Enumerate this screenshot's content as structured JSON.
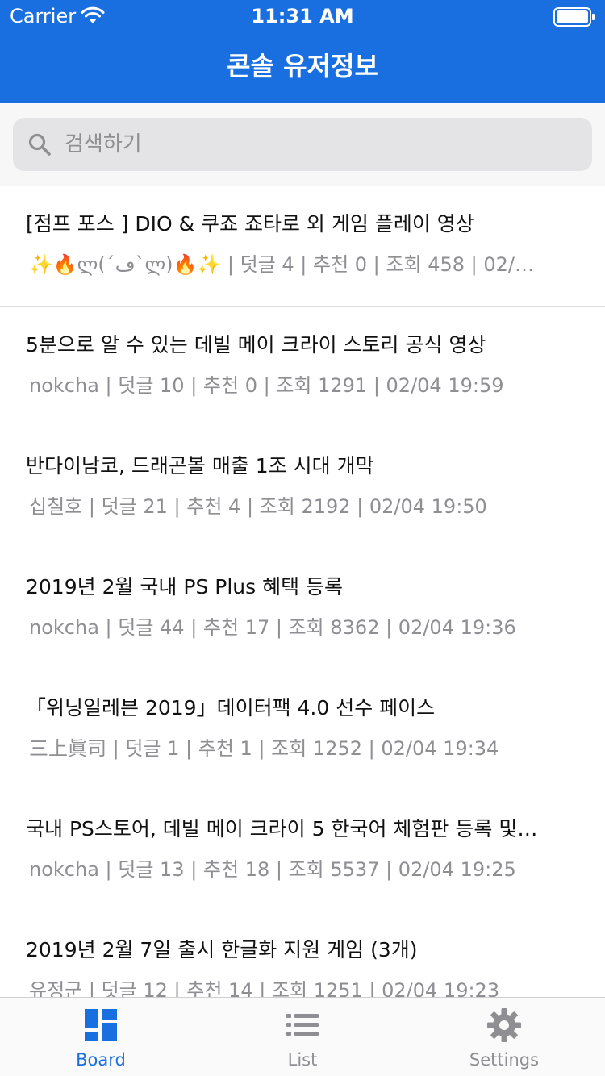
{
  "status_bar": {
    "carrier": "Carrier",
    "time": "11:31 AM"
  },
  "nav": {
    "title": "콘솔 유저정보"
  },
  "search": {
    "placeholder": "검색하기",
    "value": ""
  },
  "posts": [
    {
      "title": "[점프 포스 ] DIO & 쿠죠 죠타로 외 게임 플레이 영상",
      "meta": "✨🔥ლ(´ڡ`ლ)🔥✨ | 덧글 4 | 추천 0 | 조회 458 | 02/…"
    },
    {
      "title": "5분으로 알 수 있는 데빌 메이 크라이 스토리 공식 영상",
      "meta": "nokcha | 덧글 10 | 추천 0 | 조회 1291 | 02/04 19:59"
    },
    {
      "title": "반다이남코, 드래곤볼 매출 1조 시대 개막",
      "meta": "십칠호 | 덧글 21 | 추천 4 | 조회 2192 | 02/04 19:50"
    },
    {
      "title": "2019년 2월 국내 PS Plus 혜택 등록",
      "meta": "nokcha | 덧글 44 | 추천 17 | 조회 8362 | 02/04 19:36"
    },
    {
      "title": "「위닝일레븐 2019」데이터팩 4.0 선수 페이스",
      "meta": "三上眞司 | 덧글 1 | 추천 1 | 조회 1252 | 02/04 19:34"
    },
    {
      "title": "국내 PS스토어, 데빌 메이 크라이 5 한국어 체험판 등록 및…",
      "meta": "nokcha | 덧글 13 | 추천 18 | 조회 5537 | 02/04 19:25"
    },
    {
      "title": "2019년 2월 7일 출시 한글화 지원 게임 (3개)",
      "meta": "유정군 | 덧글 12 | 추천 14 | 조회 1251 | 02/04 19:23"
    }
  ],
  "tabs": [
    {
      "label": "Board",
      "icon": "board-icon",
      "active": true
    },
    {
      "label": "List",
      "icon": "list-icon",
      "active": false
    },
    {
      "label": "Settings",
      "icon": "gear-icon",
      "active": false
    }
  ],
  "colors": {
    "accent": "#1a6fe0",
    "inactive": "#8e8e93"
  }
}
